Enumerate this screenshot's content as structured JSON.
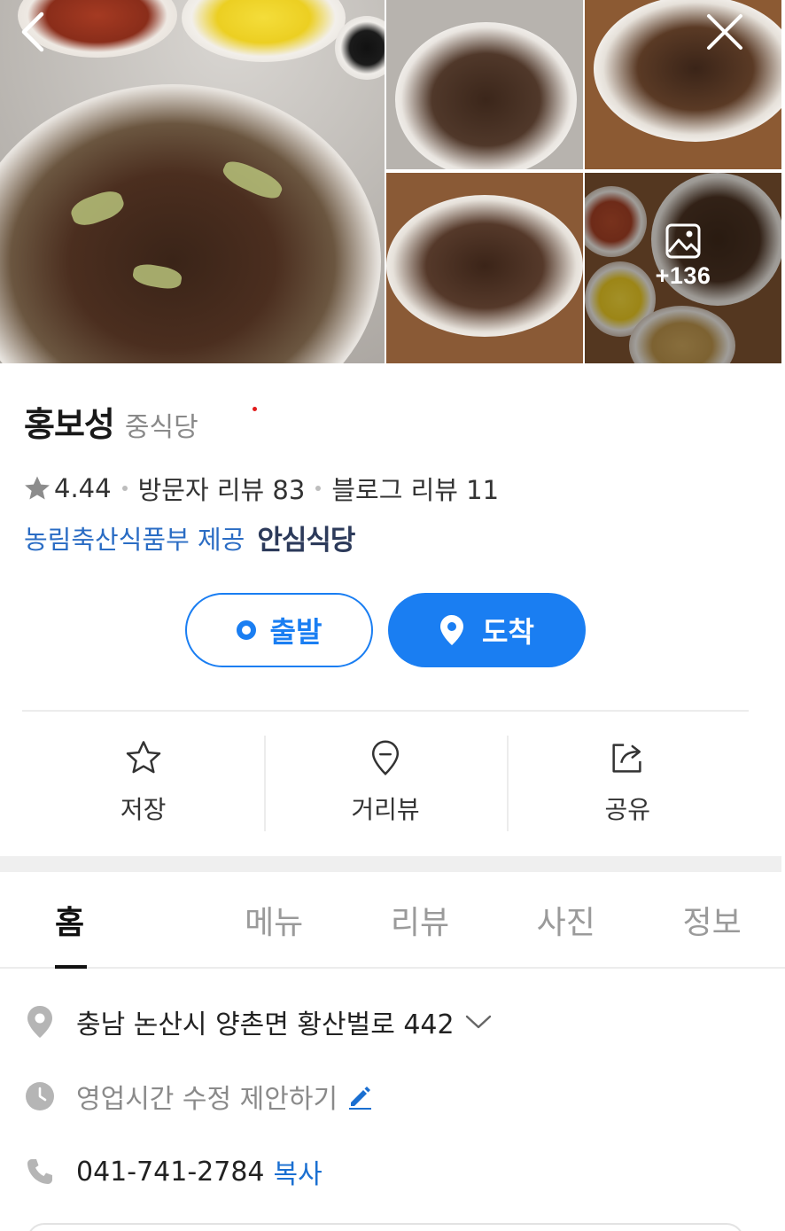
{
  "gallery": {
    "more_count": "+136"
  },
  "place": {
    "name": "홍보성",
    "category": "중식당"
  },
  "rating": {
    "score": "4.44",
    "visitor_reviews": "방문자 리뷰 83",
    "blog_reviews": "블로그 리뷰 11"
  },
  "provider": {
    "text": "농림축산식품부 제공",
    "logo_text": "안심식당"
  },
  "route": {
    "depart_label": "출발",
    "arrive_label": "도착"
  },
  "actions": {
    "save": "저장",
    "street_view": "거리뷰",
    "share": "공유"
  },
  "tabs": [
    "홈",
    "메뉴",
    "리뷰",
    "사진",
    "정보"
  ],
  "info": {
    "address": "충남 논산시 양촌면 황산벌로 442",
    "hours": "영업시간 수정 제안하기",
    "phone": "041-741-2784",
    "copy_label": "복사"
  },
  "colors": {
    "accent": "#1a7ef2",
    "link": "#2a6cc4",
    "active_tab": "#111111"
  }
}
